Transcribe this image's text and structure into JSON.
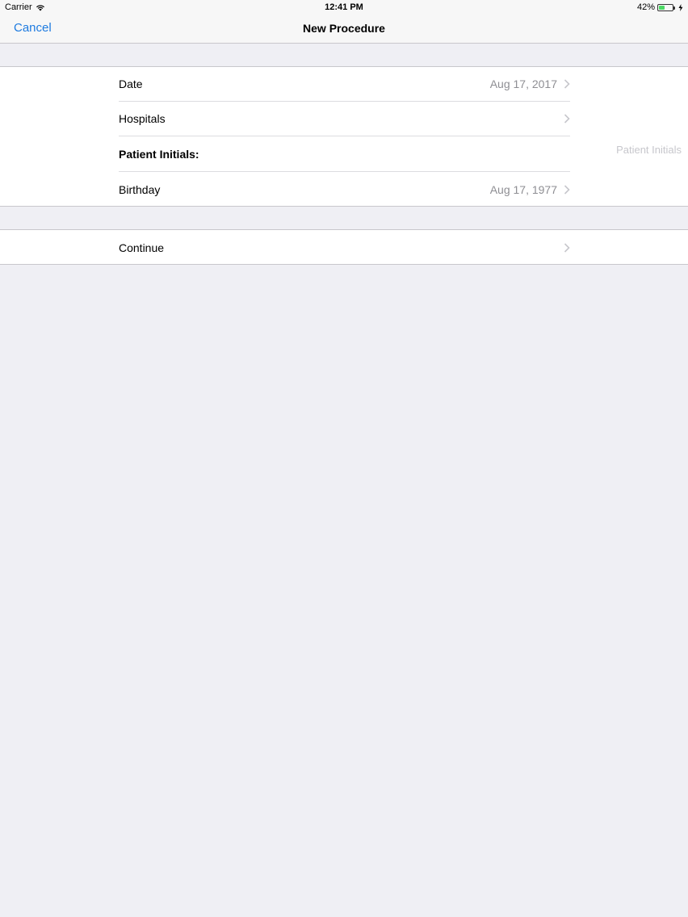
{
  "status_bar": {
    "carrier": "Carrier",
    "time": "12:41 PM",
    "battery_percent": "42%",
    "battery_level": 0.42,
    "battery_color": "#4cd964"
  },
  "nav": {
    "cancel_label": "Cancel",
    "title": "New Procedure",
    "tint_color": "#1e7be0"
  },
  "form": {
    "date": {
      "label": "Date",
      "value": "Aug 17, 2017"
    },
    "hospitals": {
      "label": "Hospitals"
    },
    "patient_initials": {
      "label": "Patient Initials:",
      "placeholder": "Patient Initials",
      "value": ""
    },
    "birthday": {
      "label": "Birthday",
      "value": "Aug 17, 1977"
    }
  },
  "actions": {
    "continue_label": "Continue"
  },
  "icons": [
    "wifi-icon",
    "battery-icon",
    "charging-icon",
    "chevron-right-icon"
  ]
}
